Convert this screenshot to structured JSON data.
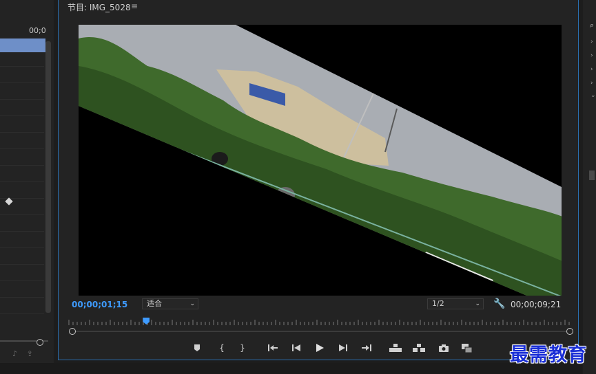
{
  "left_panel": {
    "timecode": "00;0"
  },
  "monitor": {
    "tab_title": "节目: IMG_5028",
    "tab_menu_icon": "hamburger-icon",
    "current_timecode": "00;00;01;15",
    "fit_label": "适合",
    "resolution_label": "1/2",
    "duration_timecode": "00;00;09;21",
    "playhead_fraction": 0.15
  },
  "transport_icons": [
    "marker-icon",
    "mark-in-icon",
    "mark-out-icon",
    "go-to-in-icon",
    "step-back-icon",
    "play-icon",
    "step-forward-icon",
    "go-to-out-icon",
    "lift-icon",
    "extract-icon",
    "export-frame-icon",
    "compare-icon"
  ],
  "watermark": "最需教育",
  "colors": {
    "accent": "#3e9bff",
    "panel_border": "#2a6fb0",
    "watermark": "#1a2fd6"
  }
}
